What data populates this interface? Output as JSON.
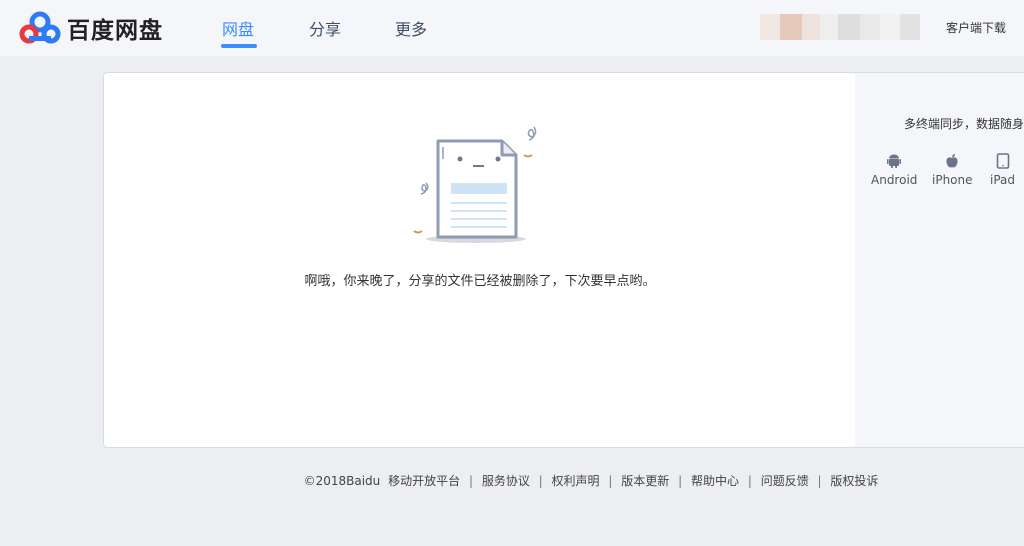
{
  "header": {
    "logo_text": "百度网盘",
    "nav": [
      {
        "label": "网盘",
        "active": true
      },
      {
        "label": "分享",
        "active": false
      },
      {
        "label": "更多",
        "active": false
      }
    ],
    "client_download": "客户端下载"
  },
  "main": {
    "message": "啊哦，你来晚了，分享的文件已经被删除了，下次要早点哟。"
  },
  "side": {
    "title": "多终端同步，数据随身",
    "devices": [
      {
        "label": "Android",
        "icon": "android-icon"
      },
      {
        "label": "iPhone",
        "icon": "apple-icon"
      },
      {
        "label": "iPad",
        "icon": "tablet-icon"
      }
    ]
  },
  "footer": {
    "copyright": "©2018Baidu",
    "links": [
      "移动开放平台",
      "服务协议",
      "权利声明",
      "版本更新",
      "帮助中心",
      "问题反馈",
      "版权投诉"
    ]
  },
  "colors": {
    "accent": "#3b8cff",
    "background": "#edeef2",
    "header_bg": "#f4f6fa"
  }
}
